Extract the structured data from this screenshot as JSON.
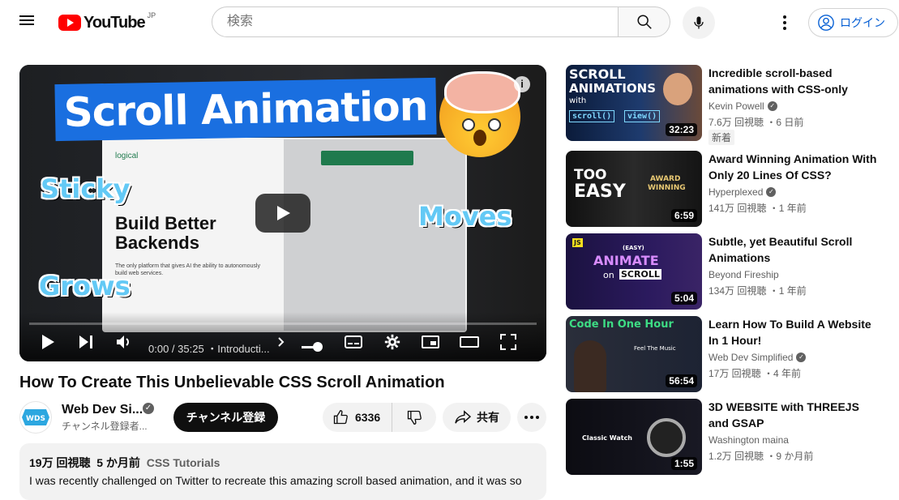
{
  "header": {
    "logo_text": "YouTube",
    "logo_region": "JP",
    "search_placeholder": "検索",
    "login_label": "ログイン",
    "colors": {
      "brand": "#ff0000",
      "link": "#065fd4"
    }
  },
  "player": {
    "thumbnail_title": "Scroll Animation",
    "sticker_sticky": "Sticky",
    "sticker_moves": "Moves",
    "sticker_grows": "Grows",
    "screen_logo": "logical",
    "screen_headline": "Build Better Backends",
    "screen_subtext": "The only platform that gives AI the ability to autonomously build web services.",
    "time": "0:00 / 35:25",
    "chapter": "・Introducti...",
    "info_icon": "i"
  },
  "video": {
    "title": "How To Create This Unbelievable CSS Scroll Animation",
    "channel_name": "Web Dev Si...",
    "avatar_text": "WDS",
    "subscribers": "チャンネル登録者...",
    "subscribe_label": "チャンネル登録",
    "likes": "6336",
    "share_label": "共有",
    "description": {
      "views": "19万 回視聴",
      "age": "5 か月前",
      "tag": "CSS Tutorials",
      "text": "I was recently challenged on Twitter to recreate this amazing scroll based animation, and it was so"
    }
  },
  "recommendations": [
    {
      "title": "Incredible scroll-based animations with CSS-only",
      "channel": "Kevin Powell",
      "stats": "7.6万 回視聴 ・6 日前",
      "badge": "新着",
      "duration": "32:23",
      "thumb_lines": [
        "SCROLL",
        "ANIMATIONS",
        "with",
        "scroll()",
        "view()"
      ]
    },
    {
      "title": "Award Winning Animation With Only 20 Lines Of CSS?",
      "channel": "Hyperplexed",
      "stats": "141万 回視聴 ・1 年前",
      "duration": "6:59",
      "thumb_lines": [
        "TOO",
        "EASY",
        "AWARD",
        "WINNING"
      ]
    },
    {
      "title": "Subtle, yet Beautiful Scroll Animations",
      "channel": "Beyond Fireship",
      "stats": "134万 回視聴 ・1 年前",
      "duration": "5:04",
      "thumb_lines": [
        "(EASY)",
        "ANIMATE",
        "on",
        "SCROLL",
        "JS"
      ]
    },
    {
      "title": "Learn How To Build A Website In 1 Hour!",
      "channel": "Web Dev Simplified",
      "stats": "17万 回視聴 ・4 年前",
      "duration": "56:54",
      "thumb_lines": [
        "Code In One Hour",
        "Feel The Music"
      ]
    },
    {
      "title": "3D WEBSITE with THREEJS and GSAP",
      "channel": "Washington maina",
      "stats": "1.2万 回視聴 ・9 か月前",
      "duration": "1:55",
      "thumb_lines": [
        "Classic Watch"
      ]
    }
  ]
}
